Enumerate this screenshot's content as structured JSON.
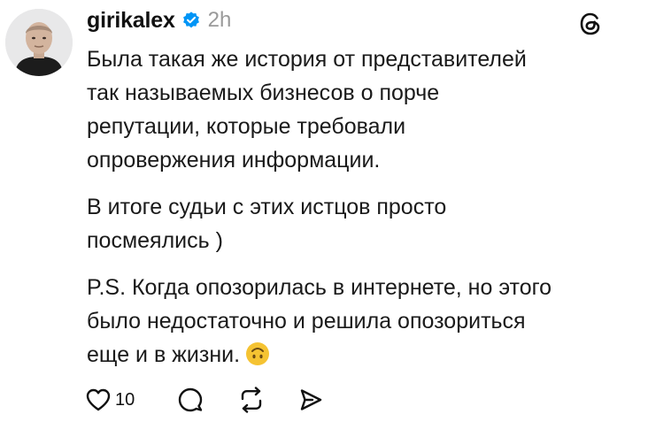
{
  "post": {
    "author": {
      "username": "girikalex",
      "verified": true,
      "time": "2h"
    },
    "paragraphs": [
      "Была такая же история от представителей\nтак называемых бизнесов о порче\nрепутации, которые требовали\nопровержения информации.",
      "В итоге судьи с этих истцов просто\nпосмеялись )",
      "P.S. Когда опозорилась в интернете, но этого\nбыло недостаточно и решила опозориться\nеще и в жизни."
    ],
    "emoji": "upside-down-face",
    "actions": {
      "like_count": "10"
    }
  },
  "colors": {
    "verified_badge": "#0095f6",
    "text": "#1a1a1a",
    "muted": "#9a9a9a",
    "emoji": "#f5c332"
  },
  "icons": [
    "threads-logo-icon",
    "verified-badge-icon",
    "heart-icon",
    "comment-icon",
    "repost-icon",
    "share-icon",
    "upside-down-face-emoji"
  ]
}
